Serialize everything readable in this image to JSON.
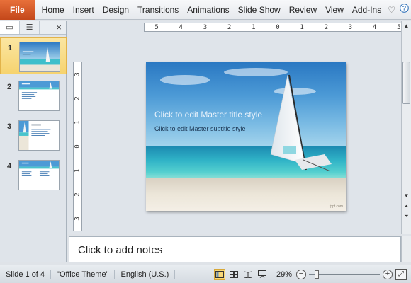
{
  "ribbon": {
    "file_label": "File",
    "tabs": [
      "Home",
      "Insert",
      "Design",
      "Transitions",
      "Animations",
      "Slide Show",
      "Review",
      "View",
      "Add-Ins"
    ],
    "right_icons": [
      "heart-icon",
      "help-icon"
    ]
  },
  "left_pane": {
    "tab_icons": [
      "slides-tab-icon",
      "outline-tab-icon"
    ],
    "close_glyph": "×",
    "slides": [
      {
        "number": "1",
        "selected": true
      },
      {
        "number": "2",
        "selected": false
      },
      {
        "number": "3",
        "selected": false
      },
      {
        "number": "4",
        "selected": false
      }
    ]
  },
  "ruler": {
    "horizontal": [
      "5",
      "4",
      "3",
      "2",
      "1",
      "0",
      "1",
      "2",
      "3",
      "4",
      "5"
    ],
    "vertical": [
      "3",
      "2",
      "1",
      "0",
      "1",
      "2",
      "3"
    ]
  },
  "slide": {
    "title": "Click to edit Master title style",
    "subtitle": "Click to edit Master subtitle style",
    "credit": "fppt.com"
  },
  "notes": {
    "placeholder": "Click to add notes"
  },
  "status_bar": {
    "slide_info": "Slide 1 of 4",
    "theme": "\"Office Theme\"",
    "language": "English (U.S.)",
    "zoom": "29%",
    "zoom_fraction": 0.29,
    "view_icons": [
      "normal-view-icon",
      "slide-sorter-icon",
      "reading-view-icon",
      "slideshow-view-icon"
    ]
  },
  "colors": {
    "file_tab": "#d35423",
    "selected_thumb": "#f6d36f"
  }
}
